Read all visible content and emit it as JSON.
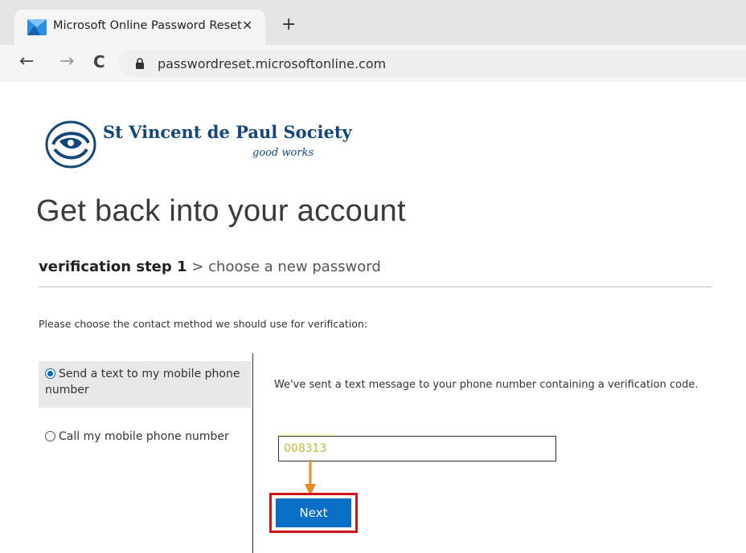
{
  "browser": {
    "tab_title": "Microsoft Online Password Reset",
    "tab_close": "✕",
    "new_tab": "+",
    "back": "←",
    "forward": "→",
    "reload": "C",
    "url": "passwordreset.microsoftonline.com"
  },
  "brand": {
    "org_name": "St Vincent de Paul Society",
    "tagline": "good works",
    "color": "#13467a"
  },
  "page": {
    "title": "Get back into your account",
    "breadcrumb": {
      "current": "verification step 1",
      "separator": ">",
      "next": "choose a new password"
    },
    "instruction": "Please choose the contact method we should use for verification:"
  },
  "options": [
    {
      "label": "Send a text to my mobile phone number",
      "selected": true
    },
    {
      "label": "Call my mobile phone number",
      "selected": false
    }
  ],
  "verification": {
    "message": "We've sent a text message to your phone number containing a verification code.",
    "code_value": "008313",
    "next_label": "Next"
  },
  "colors": {
    "accent": "#0b6fc7",
    "highlight_outline": "#d0141a",
    "arrow": "#e8892a"
  }
}
